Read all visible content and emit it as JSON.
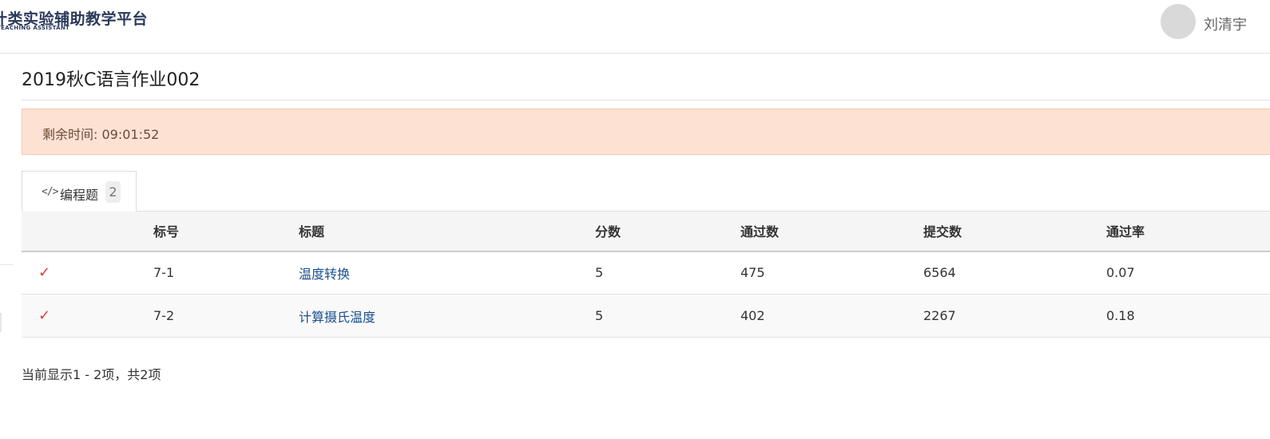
{
  "header": {
    "logo_title": "计类实验辅助教学平台",
    "logo_subtitle": "TEACHING ASSISTANT",
    "username": "刘清宇"
  },
  "page": {
    "title": "2019秋C语言作业002"
  },
  "alert": {
    "text": "剩余时间: 09:01:52"
  },
  "tabs": [
    {
      "icon": "code-icon",
      "icon_glyph": "</>",
      "label": "编程题",
      "count": "2"
    }
  ],
  "table": {
    "columns": [
      "",
      "标号",
      "标题",
      "分数",
      "通过数",
      "提交数",
      "通过率"
    ],
    "rows": [
      {
        "status": "✓",
        "number": "7-1",
        "title": "温度转换",
        "score": "5",
        "passed": "475",
        "submitted": "6564",
        "rate": "0.07"
      },
      {
        "status": "✓",
        "number": "7-2",
        "title": "计算摄氏温度",
        "score": "5",
        "passed": "402",
        "submitted": "2267",
        "rate": "0.18"
      }
    ]
  },
  "footer": {
    "summary": "当前显示1 - 2项，共2项"
  },
  "colors": {
    "alert_bg": "#fde2d4",
    "link": "#1a4f8f",
    "check": "#e53935",
    "brand": "#2b3a5c"
  }
}
